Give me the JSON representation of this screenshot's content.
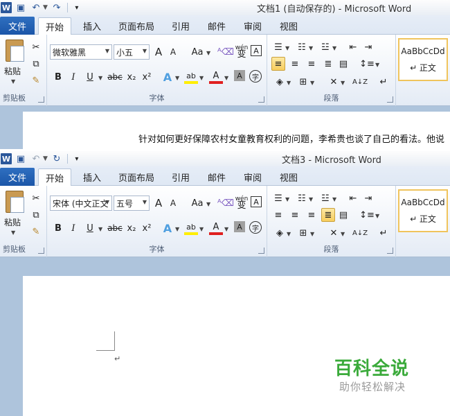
{
  "window1": {
    "title": "文档1 (自动保存的)  -  Microsoft Word",
    "font_name": "微软雅黑",
    "font_size": "小五",
    "doc_text": "针对如何更好保障农村女童教育权利的问题，李希贵也谈了自己的看法。他说"
  },
  "window2": {
    "title": "文档3  -  Microsoft Word",
    "font_name": "宋体 (中文正文",
    "font_size": "五号"
  },
  "tabs": {
    "file": "文件",
    "home": "开始",
    "insert": "插入",
    "layout": "页面布局",
    "references": "引用",
    "mailings": "邮件",
    "review": "审阅",
    "view": "视图"
  },
  "groups": {
    "clipboard": "剪贴板",
    "font": "字体",
    "paragraph": "段落"
  },
  "paste_label": "粘贴",
  "styles": {
    "sample": "AaBbCcDd",
    "name": "↵ 正文"
  },
  "toolbar_glyphs": {
    "grow": "A",
    "shrink": "A",
    "case": "Aa",
    "phonetic": "wén",
    "phonetic_glyph": "变",
    "charborder": "A",
    "bold": "B",
    "italic": "I",
    "underline": "U",
    "strike": "abc",
    "sub": "x₂",
    "sup": "x²",
    "effects": "A",
    "highlight": "ab",
    "fontcolor": "A",
    "shading": "A",
    "enclose": "字"
  },
  "para_mark": "↵",
  "watermark": {
    "title": "百科全说",
    "subtitle": "助你轻松解决"
  },
  "colors": {
    "file_tab": "#2b6cc0",
    "accent_word": "#2b579a",
    "watermark_green": "#3aaa3a",
    "ribbon_bg": "#e4ebf5",
    "selected_button": "#f7cd5d"
  }
}
